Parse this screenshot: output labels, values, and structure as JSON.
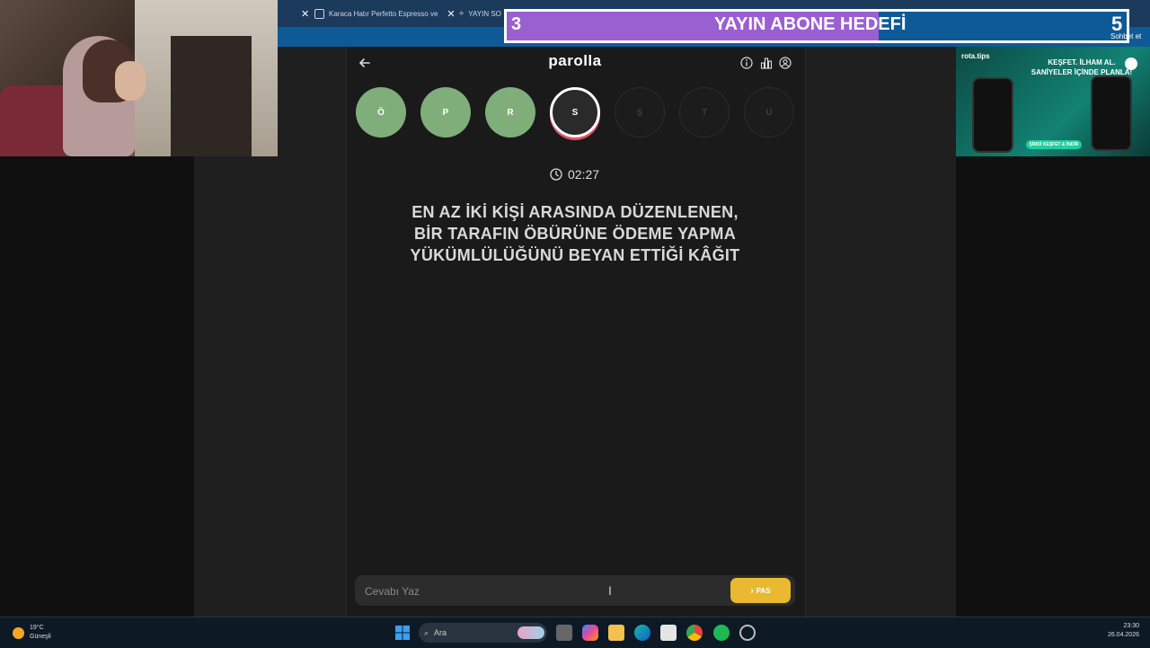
{
  "browser": {
    "tabs": [
      {
        "label": "Karaca Hatır Perfetto Espresso ve"
      },
      {
        "label": "YAYIN SO"
      }
    ],
    "sohbet_label": "Sohbet et"
  },
  "overlay": {
    "goal_current": "3",
    "goal_title": "YAYIN ABONE HEDEFİ",
    "goal_target": "5",
    "goal_progress_fraction": 0.6,
    "fill_color": "#9a5fd0"
  },
  "ad": {
    "brand": "rota.tips",
    "headline_1": "KEŞFET. İLHAM AL.",
    "headline_2": "SANİYELER İÇİNDE PLANLA!",
    "cta": "ŞİMDİ KEŞFET & İNDİR"
  },
  "app": {
    "title": "parolla",
    "letters": [
      {
        "char": "Ö",
        "state": "done"
      },
      {
        "char": "P",
        "state": "done"
      },
      {
        "char": "R",
        "state": "done"
      },
      {
        "char": "S",
        "state": "active"
      },
      {
        "char": "Ş",
        "state": "future"
      },
      {
        "char": "T",
        "state": "future"
      },
      {
        "char": "U",
        "state": "future"
      }
    ],
    "timer": "02:27",
    "question_lines": [
      "EN AZ İKİ KİŞİ ARASINDA DÜZENLENEN,",
      "BİR TARAFIN ÖBÜRÜNE ÖDEME YAPMA",
      "YÜKÜMLÜLÜĞÜNÜ BEYAN ETTİĞİ KÂĞIT"
    ],
    "answer_placeholder": "Cevabı Yaz",
    "pass_label": "PAS",
    "colors": {
      "done": "#7fae7b",
      "pass": "#e8b931",
      "active_ring": "#e05263"
    }
  },
  "taskbar": {
    "temperature": "19°C",
    "weather": "Güneşli",
    "search_label": "Ara",
    "time": "23:30",
    "date": "26.04.2026"
  }
}
